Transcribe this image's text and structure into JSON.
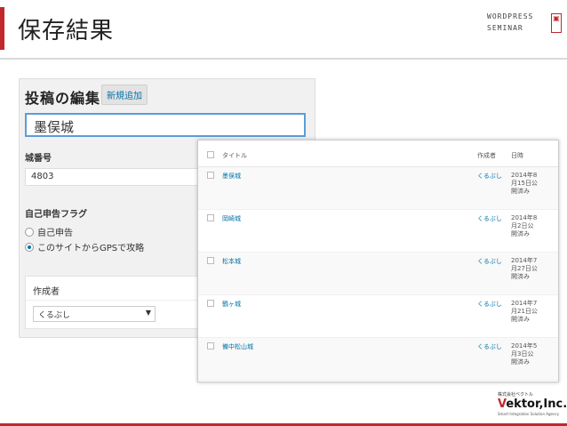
{
  "slide": {
    "title": "保存結果",
    "brand_line1": "WORDPRESS",
    "brand_line2": "SEMINAR"
  },
  "edit_panel": {
    "heading": "投稿の編集",
    "add_new": "新規追加",
    "title_value": "墨俣城",
    "castle_number_label": "城番号",
    "castle_number_value": "4803",
    "flag_label": "自己申告フラグ",
    "radio_options": [
      "自己申告",
      "このサイトからGPSで攻略"
    ],
    "radio_selected": 1,
    "author_box_label": "作成者",
    "author_selected": "くるぶし"
  },
  "post_list": {
    "columns": {
      "title": "タイトル",
      "author": "作成者",
      "date": "日時"
    },
    "rows": [
      {
        "title": "墨俣城",
        "author": "くるぶし",
        "date": "2014年8月15日公開済み"
      },
      {
        "title": "岡崎城",
        "author": "くるぶし",
        "date": "2014年8月2日公開済み"
      },
      {
        "title": "松本城",
        "author": "くるぶし",
        "date": "2014年7月27日公開済み"
      },
      {
        "title": "鶴ヶ城",
        "author": "くるぶし",
        "date": "2014年7月21日公開済み"
      },
      {
        "title": "備中松山城",
        "author": "くるぶし",
        "date": "2014年5月3日公開済み"
      }
    ]
  },
  "footer": {
    "company_small": "株式会社ベクトル",
    "company_v": "V",
    "company_rest": "ektor,Inc.",
    "tagline": "Smart Integration Solution Agency"
  },
  "colors": {
    "accent": "#c1272d",
    "link": "#0073aa",
    "focus": "#5b9dd9"
  }
}
